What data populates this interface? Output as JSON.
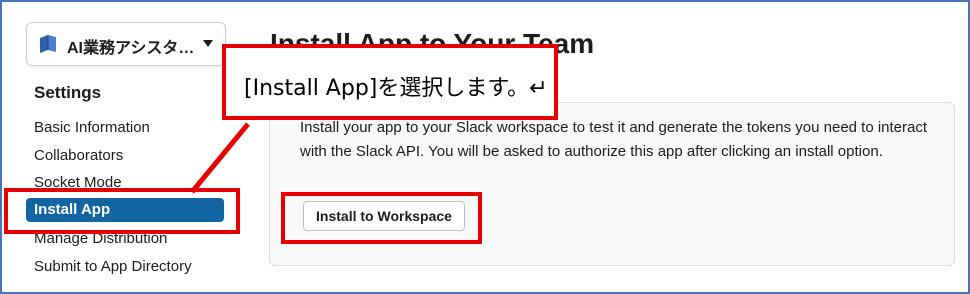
{
  "app_selector": {
    "name": "AI業務アシスタ…",
    "icon": "book-icon",
    "caret": "chevron-down-icon"
  },
  "sidebar": {
    "heading": "Settings",
    "items": [
      {
        "label": "Basic Information",
        "active": false
      },
      {
        "label": "Collaborators",
        "active": false
      },
      {
        "label": "Socket Mode",
        "active": false
      },
      {
        "label": "Install App",
        "active": true
      },
      {
        "label": "Manage Distribution",
        "active": false
      },
      {
        "label": "Submit to App Directory",
        "active": false
      }
    ]
  },
  "main": {
    "title": "Install App to Your Team",
    "description": "Install your app to your Slack workspace to test it and generate the tokens you need to interact with the Slack API. You will be asked to authorize this app after clicking an install option.",
    "install_button": "Install to Workspace"
  },
  "annotation": {
    "callout_text": "[Install App]を選択します。↵"
  },
  "colors": {
    "accent": "#1264a3",
    "annotation_red": "#e60000",
    "frame_border": "#4a74b4"
  }
}
